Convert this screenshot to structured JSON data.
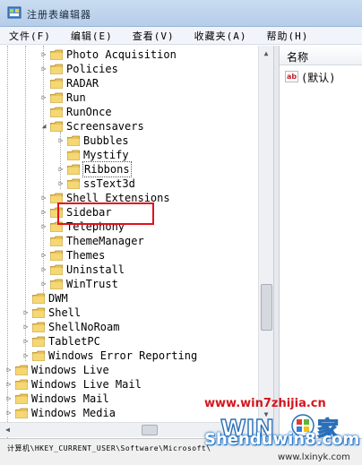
{
  "window": {
    "title": "注册表编辑器"
  },
  "menu": [
    {
      "label": "文件(F)"
    },
    {
      "label": "编辑(E)"
    },
    {
      "label": "查看(V)"
    },
    {
      "label": "收藏夹(A)"
    },
    {
      "label": "帮助(H)"
    }
  ],
  "tree": {
    "items": [
      {
        "label": "Photo Acquisition"
      },
      {
        "label": "Policies"
      },
      {
        "label": "RADAR"
      },
      {
        "label": "Run"
      },
      {
        "label": "RunOnce"
      },
      {
        "label": "Screensavers"
      },
      {
        "label": "Bubbles"
      },
      {
        "label": "Mystify"
      },
      {
        "label": "Ribbons"
      },
      {
        "label": "ssText3d"
      },
      {
        "label": "Shell Extensions"
      },
      {
        "label": "Sidebar"
      },
      {
        "label": "Telephony"
      },
      {
        "label": "ThemeManager"
      },
      {
        "label": "Themes"
      },
      {
        "label": "Uninstall"
      },
      {
        "label": "WinTrust"
      },
      {
        "label": "DWM"
      },
      {
        "label": "Shell"
      },
      {
        "label": "ShellNoRoam"
      },
      {
        "label": "TabletPC"
      },
      {
        "label": "Windows Error Reporting"
      },
      {
        "label": "Windows Live"
      },
      {
        "label": "Windows Live Mail"
      },
      {
        "label": "Windows Mail"
      },
      {
        "label": "Windows Media"
      }
    ],
    "selected": "Ribbons"
  },
  "list": {
    "column_name": "名称",
    "rows": [
      {
        "name": "(默认)"
      }
    ]
  },
  "status": {
    "path": "计算机\\HKEY_CURRENT_USER\\Software\\Microsoft\\"
  },
  "watermarks": {
    "site": "www.win7zhijia.cn",
    "brand": "Shenduwin8.com",
    "url": "www.lxinyk.com"
  },
  "colors": {
    "folder": "#e8c35a",
    "highlight": "#e0121c",
    "titlebar": "#c9dcf1"
  }
}
